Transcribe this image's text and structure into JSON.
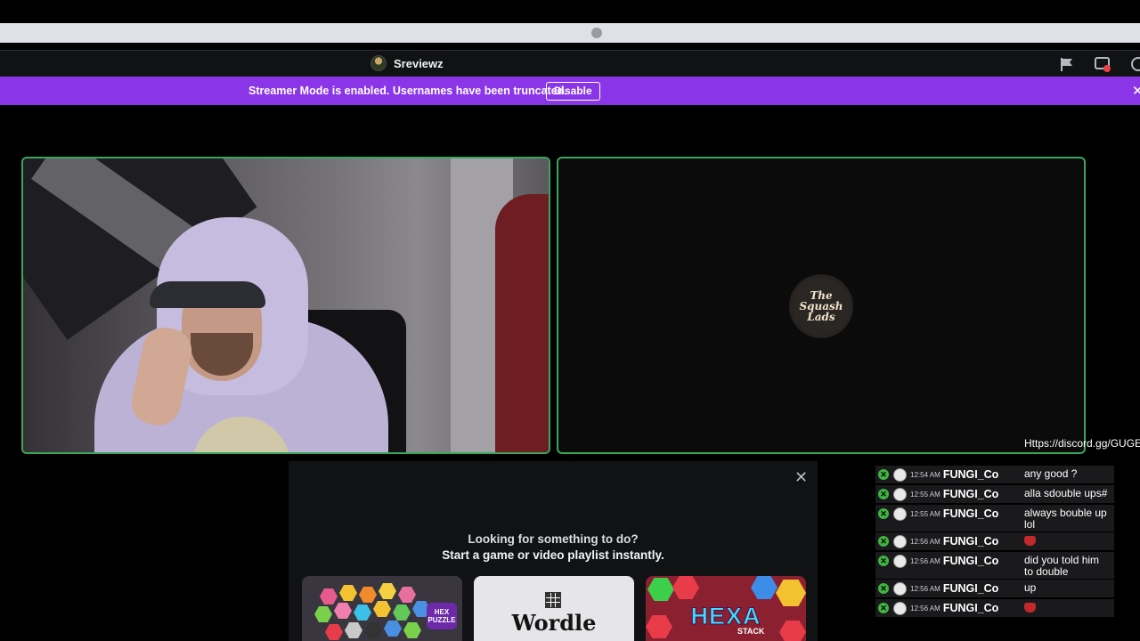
{
  "header": {
    "channel_name": "Sreviewz"
  },
  "banner": {
    "text": "Streamer Mode is enabled. Usernames have been truncated.",
    "disable_label": "Disable",
    "close_glyph": "✕"
  },
  "tiles": {
    "right_logo_lines": [
      "The",
      "Squash",
      "Lads"
    ]
  },
  "activity": {
    "close_glyph": "✕",
    "line1": "Looking for something to do?",
    "line2": "Start a game or video playlist instantly.",
    "cards": [
      {
        "name": "hex-puzzle",
        "badge": "HEX PUZZLE"
      },
      {
        "name": "wordle",
        "title": "Wordle"
      },
      {
        "name": "hexa-stack",
        "title": "HEXA",
        "subtitle": "STACK"
      }
    ]
  },
  "chat": {
    "pinned_text": "Https://discord.gg/GUGEWDhTxZ",
    "messages": [
      {
        "time": "12:54 AM",
        "user": "FUNGI_Co",
        "text": "any good ?"
      },
      {
        "time": "12:55 AM",
        "user": "FUNGI_Co",
        "text": "alla sdouble ups#"
      },
      {
        "time": "12:55 AM",
        "user": "FUNGI_Co",
        "text": "always bouble up lol"
      },
      {
        "time": "12:56 AM",
        "user": "FUNGI_Co",
        "text": ""
      },
      {
        "time": "12:56 AM",
        "user": "FUNGI_Co",
        "text": "did you told him to double"
      },
      {
        "time": "12:56 AM",
        "user": "FUNGI_Co",
        "text": "up"
      },
      {
        "time": "12:56 AM",
        "user": "FUNGI_Co",
        "text": ""
      }
    ]
  },
  "colors": {
    "banner": "#8a35e8",
    "speaking_border": "#3ba55c",
    "xbox_green": "#3fb542"
  }
}
